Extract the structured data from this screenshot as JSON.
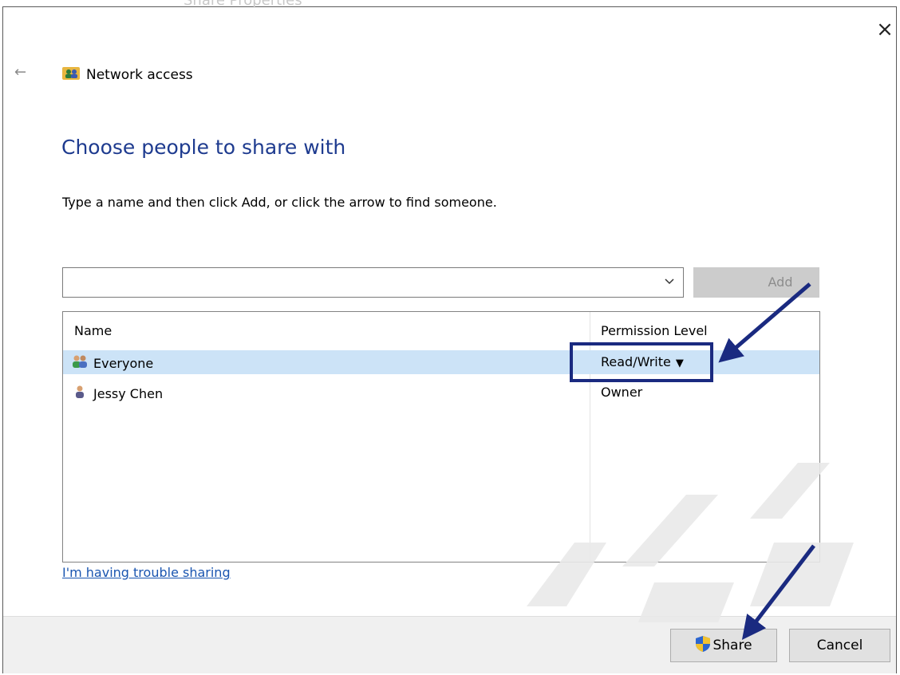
{
  "window": {
    "ghost_title": "Share Properties",
    "close_glyph": "×"
  },
  "header": {
    "back_glyph": "←",
    "nav_title": "Network access",
    "nav_icon": "network-users-icon"
  },
  "main": {
    "title": "Choose people to share with",
    "instruction": "Type a name and then click Add, or click the arrow to find someone.",
    "name_input": {
      "value": "",
      "placeholder": ""
    },
    "add_label": "Add",
    "list": {
      "columns": [
        "Name",
        "Permission Level"
      ],
      "rows": [
        {
          "name": "Everyone",
          "permission": "Read/Write",
          "icon": "group-users-icon",
          "selected": true,
          "has_dropdown": true
        },
        {
          "name": "Jessy Chen",
          "permission": "Owner",
          "icon": "user-icon",
          "selected": false,
          "has_dropdown": false
        }
      ]
    },
    "trouble_link": "I'm having trouble sharing"
  },
  "footer": {
    "share_label": "Share",
    "cancel_label": "Cancel"
  },
  "colors": {
    "title": "#1e3b8f",
    "annotation": "#1a2a80",
    "selected_row": "#cce3f7",
    "link": "#1a55b0"
  }
}
